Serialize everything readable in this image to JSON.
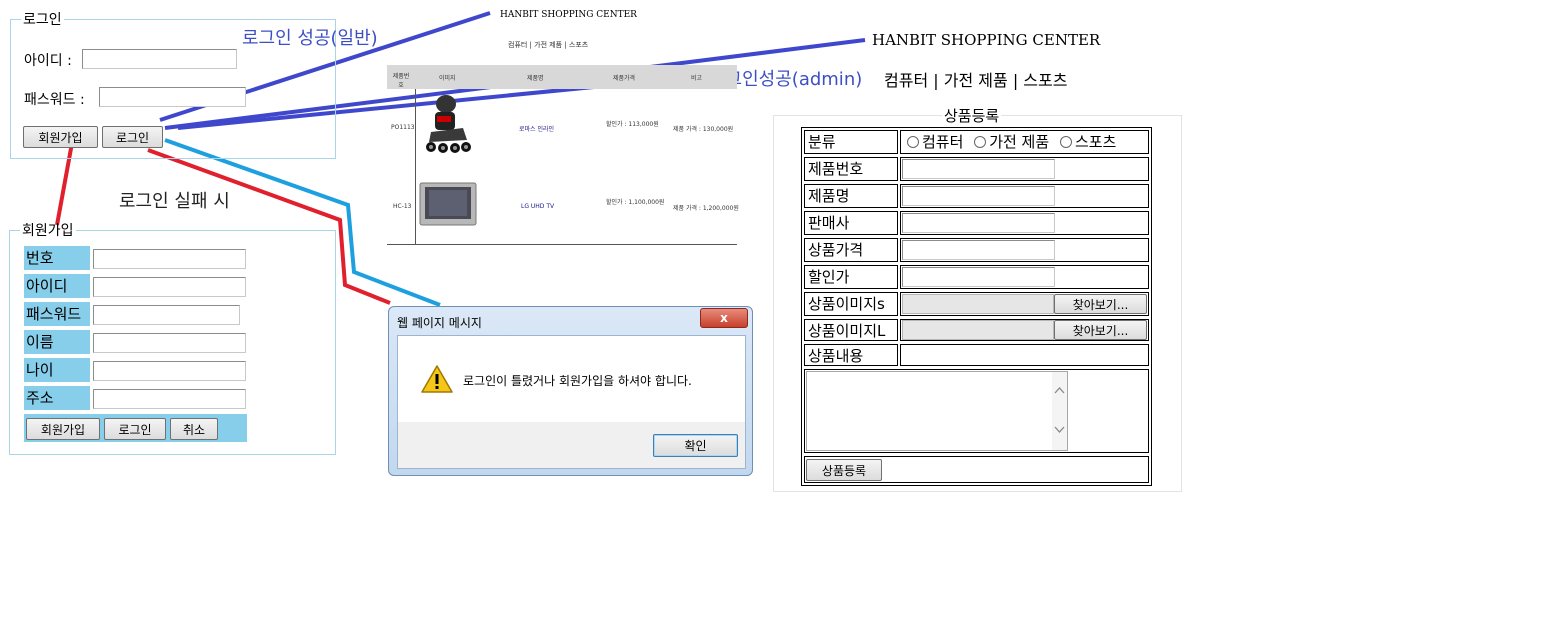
{
  "login": {
    "legend": "로그인",
    "id_label": "아이디 :",
    "pw_label": "패스워드 :",
    "join_button": "회원가입",
    "login_button": "로그인"
  },
  "annotations": {
    "login_success_normal": "로그인 성공(일반)",
    "login_success_admin": "로그인성공(admin)",
    "login_fail": "로그인 실패 시",
    "colors": {
      "blue_line": "#3f48cc",
      "cyan_line": "#1ea0e0",
      "red_line": "#e0202c"
    }
  },
  "join": {
    "legend": "회원가입",
    "fields": [
      "번호",
      "아이디",
      "패스워드",
      "이름",
      "나이",
      "주소"
    ],
    "buttons": {
      "join": "회원가입",
      "login": "로그인",
      "cancel": "취소"
    },
    "accent": "#87ceeb"
  },
  "shop_preview": {
    "title": "HANBIT SHOPPING CENTER",
    "nav": "컴퓨터 | 가전 제품 | 스포츠",
    "headers": [
      "제품번호",
      "이미지",
      "제품명",
      "제품가격",
      "비고"
    ],
    "rows": [
      {
        "code": "PO1113",
        "name": "로마스 인라인",
        "price": "할인가 : 113,000원",
        "note": "제품 가격 : 130,000원"
      },
      {
        "code": "HC-13",
        "name": "LG UHD TV",
        "price": "할인가 : 1,100,000원",
        "note": "제품 가격 : 1,200,000원"
      }
    ]
  },
  "shop_header": {
    "title": "HANBIT SHOPPING CENTER",
    "nav": {
      "computer": "컴퓨터",
      "appliance": "가전 제품",
      "sports": "스포츠",
      "sep": "|"
    }
  },
  "product_register": {
    "legend": "상품등록",
    "rows": {
      "category": "분류",
      "product_no": "제품번호",
      "product_name": "제품명",
      "seller": "판매사",
      "price": "상품가격",
      "discount": "할인가",
      "image_s": "상품이미지s",
      "image_l": "상품이미지L",
      "content": "상품내용"
    },
    "category_options": [
      "컴퓨터",
      "가전 제품",
      "스포츠"
    ],
    "browse_label": "찾아보기...",
    "submit": "상품등록"
  },
  "dialog": {
    "title": "웹 페이지 메시지",
    "message": "로그인이 틀렸거나 회원가입을 하셔야 합니다.",
    "ok": "확인",
    "close": "x"
  }
}
